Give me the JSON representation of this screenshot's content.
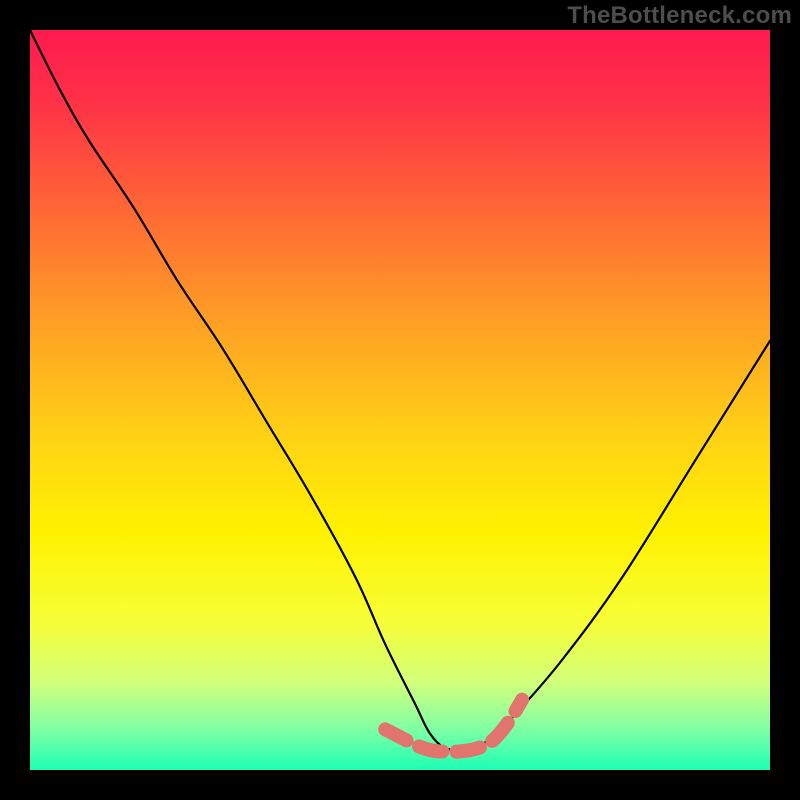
{
  "watermark": "TheBottleneck.com",
  "gradient": {
    "stops": [
      {
        "offset": 0.0,
        "color": "#ff1a4f"
      },
      {
        "offset": 0.1,
        "color": "#ff3247"
      },
      {
        "offset": 0.25,
        "color": "#ff6a34"
      },
      {
        "offset": 0.4,
        "color": "#ffa124"
      },
      {
        "offset": 0.55,
        "color": "#ffd215"
      },
      {
        "offset": 0.68,
        "color": "#fff200"
      },
      {
        "offset": 0.8,
        "color": "#f6ff37"
      },
      {
        "offset": 0.88,
        "color": "#d3ff7a"
      },
      {
        "offset": 0.94,
        "color": "#87ffa2"
      },
      {
        "offset": 1.0,
        "color": "#1dffb5"
      }
    ]
  },
  "accent_color": "#e1746d",
  "chart_data": {
    "type": "line",
    "xlabel": "",
    "ylabel": "",
    "title": "",
    "xlim": [
      0,
      100
    ],
    "ylim": [
      0,
      100
    ],
    "series": [
      {
        "name": "black-curve",
        "x": [
          0,
          4,
          8,
          14,
          20,
          26,
          32,
          38,
          44,
          48,
          52,
          54,
          56,
          58,
          62,
          66,
          72,
          80,
          90,
          100
        ],
        "y": [
          100,
          92,
          85,
          76,
          66,
          57,
          47,
          37,
          26,
          17,
          9,
          5,
          3,
          3,
          4,
          8,
          15,
          26,
          42,
          58
        ]
      },
      {
        "name": "pink-highlight",
        "x": [
          48,
          50.5,
          52.5,
          54.5,
          56,
          58,
          60,
          62,
          63.5,
          65,
          66.5
        ],
        "y": [
          5.5,
          4.2,
          3.2,
          2.6,
          2.5,
          2.5,
          2.8,
          3.6,
          5,
          7,
          9.5
        ]
      }
    ]
  }
}
